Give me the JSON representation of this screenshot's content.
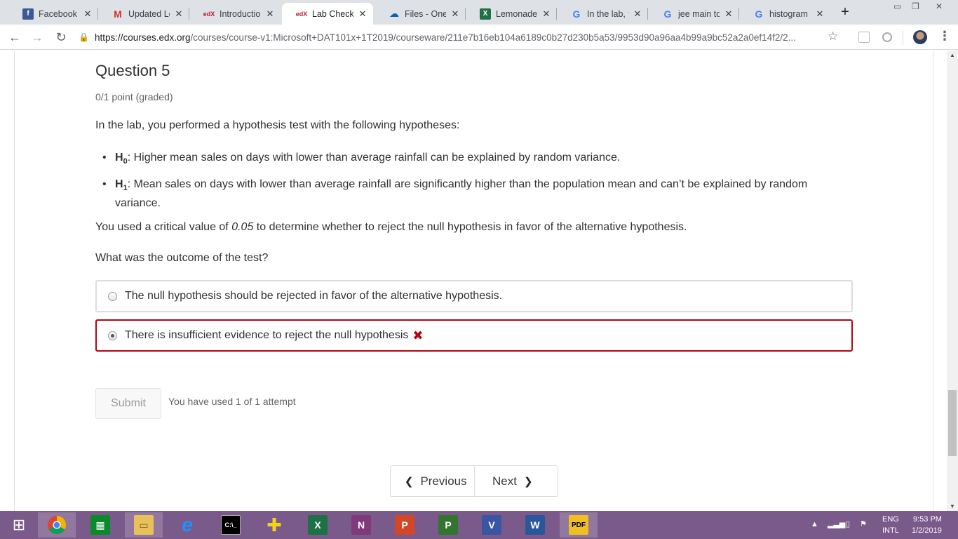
{
  "browser": {
    "tabs": [
      {
        "title": "Facebook",
        "favicon": "facebook-icon",
        "active": false
      },
      {
        "title": "Updated Lea",
        "favicon": "gmail-icon",
        "active": false
      },
      {
        "title": "Introduction",
        "favicon": "edx-icon",
        "active": false
      },
      {
        "title": "Lab Check | I",
        "favicon": "edx-icon",
        "active": true
      },
      {
        "title": "Files - OneD",
        "favicon": "onedrive-icon",
        "active": false
      },
      {
        "title": "Lemonade.x",
        "favicon": "excel-icon",
        "active": false
      },
      {
        "title": "In the lab, yo",
        "favicon": "google-icon",
        "active": false
      },
      {
        "title": "jee main tot",
        "favicon": "google-icon",
        "active": false
      },
      {
        "title": "histogram in",
        "favicon": "google-icon",
        "active": false
      }
    ],
    "new_tab_label": "+",
    "close_glyph": "✕",
    "url_host": "https://courses.edx.org",
    "url_path": "/courses/course-v1:Microsoft+DAT101x+1T2019/courseware/211e7b16eb104a6189c0b27d230b5a53/9953d90a96aa4b99a9bc52a2a0ef14f2/2..."
  },
  "question": {
    "title": "Question 5",
    "points": "0/1 point (graded)",
    "intro": "In the lab, you performed a hypothesis test with the following hypotheses:",
    "hypotheses": [
      {
        "label": "H",
        "sub": "0",
        "text": ": Higher mean sales on days with lower than average rainfall can be explained by random variance."
      },
      {
        "label": "H",
        "sub": "1",
        "text": ": Mean sales on days with lower than average rainfall are significantly higher than the population mean and can’t be explained by random variance."
      }
    ],
    "critical_pre": "You used a critical value of ",
    "critical_value": "0.05",
    "critical_post": " to determine whether to reject the null hypothesis in favor of the alternative hypothesis.",
    "ask": "What was the outcome of the test?",
    "options": [
      {
        "text": "The null hypothesis should be rejected in favor of the alternative hypothesis.",
        "selected": false,
        "status": ""
      },
      {
        "text": "There is insufficient evidence to reject the null hypothesis",
        "selected": true,
        "status": "incorrect"
      }
    ],
    "incorrect_glyph": "✖",
    "submit_label": "Submit",
    "attempts_text": "You have used 1 of 1 attempt"
  },
  "pager": {
    "previous_label": "Previous",
    "next_label": "Next"
  },
  "taskbar": {
    "apps": [
      "start-icon",
      "chrome-icon",
      "store-icon",
      "file-explorer-icon",
      "edge-icon",
      "cmd-icon",
      "paint-icon",
      "excel-icon",
      "onenote-icon",
      "powerpoint-icon",
      "project-icon",
      "visio-icon",
      "word-icon",
      "pdf-icon"
    ],
    "lang_line1": "ENG",
    "lang_line2": "INTL",
    "time": "9:53 PM",
    "date": "1/2/2019"
  },
  "colors": {
    "incorrect": "#b20610",
    "taskbar": "#7a5a8a",
    "tab_strip": "#dee1e6"
  }
}
